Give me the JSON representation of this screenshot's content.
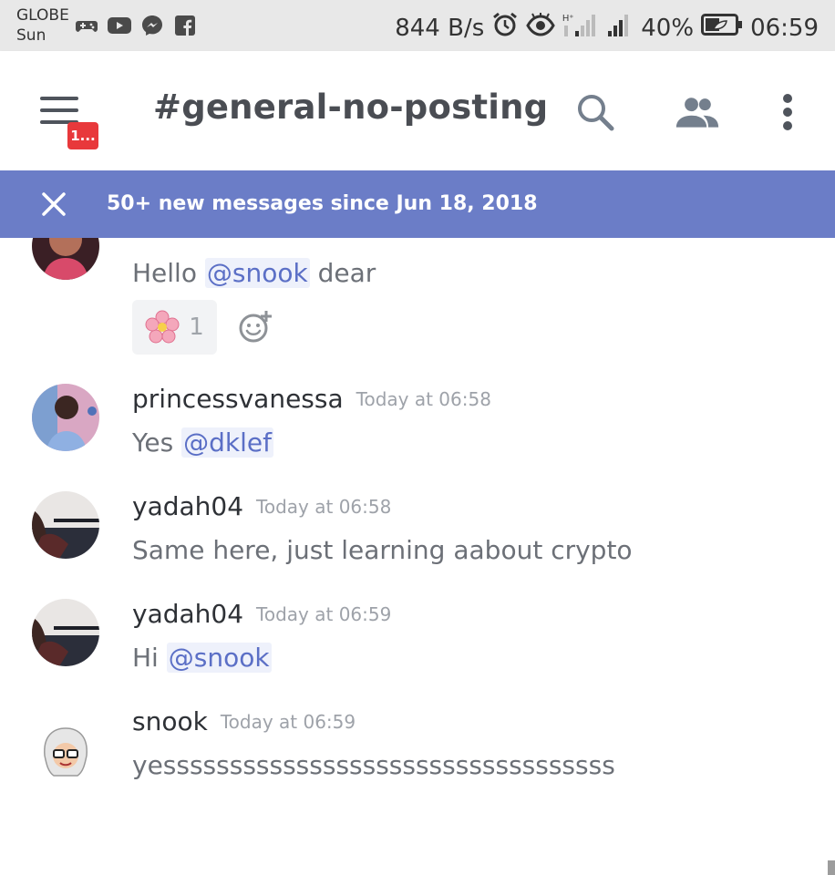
{
  "status_bar": {
    "carrier_line1": "GLOBE",
    "carrier_line2": "Sun",
    "speed": "844 B/s",
    "battery_pct": "40%",
    "time": "06:59",
    "icons_left": [
      "gamepad-icon",
      "youtube-icon",
      "messenger-icon",
      "facebook-icon"
    ],
    "icons_right": [
      "alarm-icon",
      "eye-icon",
      "signal-hplus-icon",
      "signal-icon",
      "battery-icon"
    ]
  },
  "header": {
    "channel_name": "#general-no-posting",
    "menu_badge": "1...",
    "icons": [
      "menu-icon",
      "search-icon",
      "members-icon",
      "more-vertical-icon"
    ]
  },
  "banner": {
    "text": "50+ new messages since Jun 18, 2018"
  },
  "messages": [
    {
      "author": "",
      "timestamp": "",
      "text_before": "Hello ",
      "mention": "@snook",
      "text_after": " dear",
      "reaction": {
        "emoji": "cherry-blossom",
        "count": "1"
      }
    },
    {
      "author": "princessvanessa",
      "timestamp": "Today at 06:58",
      "text_before": "Yes ",
      "mention": "@dklef",
      "text_after": ""
    },
    {
      "author": "yadah04",
      "timestamp": "Today at 06:58",
      "text": "Same here, just learning aabout crypto"
    },
    {
      "author": "yadah04",
      "timestamp": "Today at 06:59",
      "text_before": "Hi ",
      "mention": "@snook",
      "text_after": ""
    },
    {
      "author": "snook",
      "timestamp": "Today at 06:59",
      "text": "yessssssssssssssssssssssssssssssssss"
    }
  ],
  "colors": {
    "banner_bg": "#6b7dc7",
    "mention_text": "#5b6fc6",
    "mention_bg": "#eef1fb",
    "badge_bg": "#e8383b"
  }
}
